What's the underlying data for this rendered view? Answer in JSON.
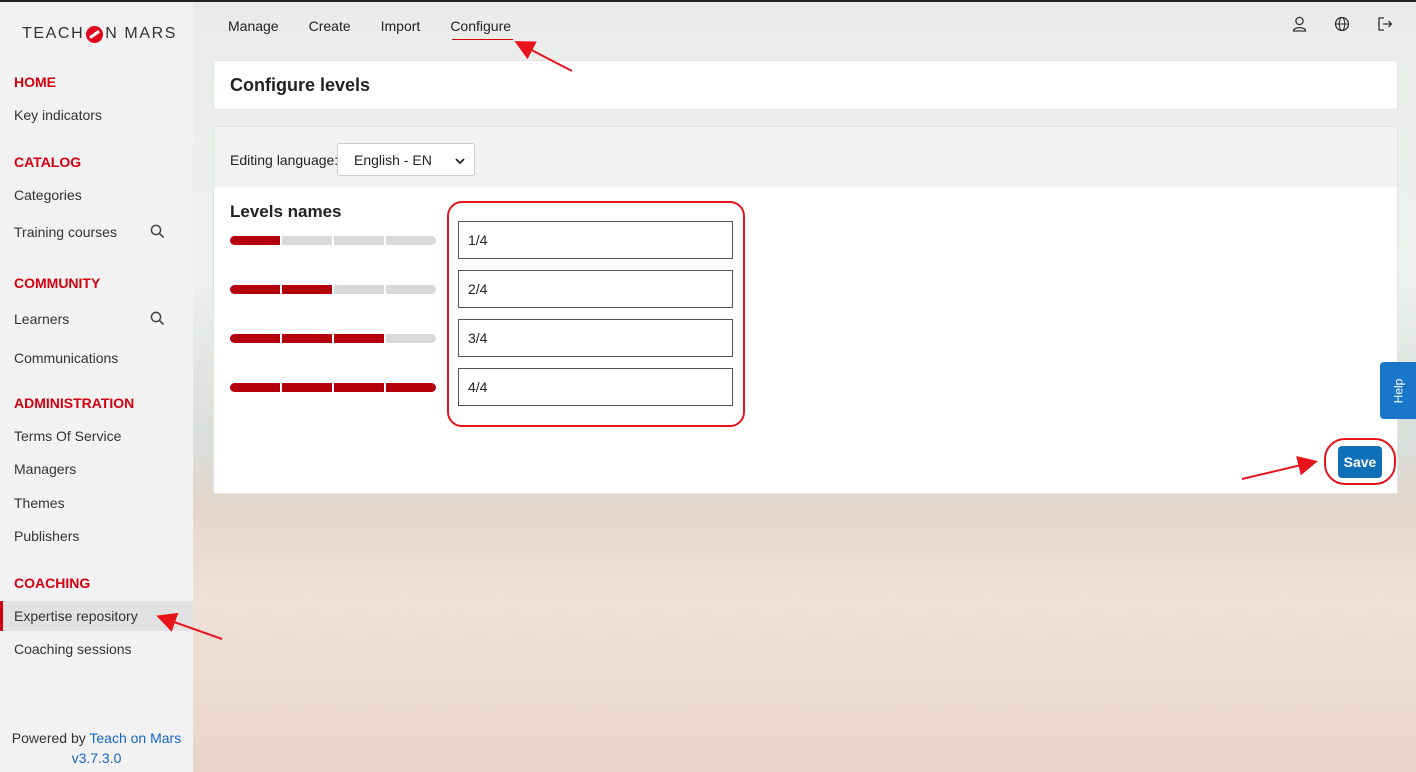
{
  "brand": {
    "logo_left": "TEACH",
    "logo_right": "N MARS",
    "logo_icon": "mars-o-logo-icon",
    "accent_color": "#d4000f",
    "primary_color": "#0f6fb8"
  },
  "sidebar": {
    "sections": [
      {
        "title": "HOME",
        "items": [
          {
            "label": "Key indicators"
          }
        ]
      },
      {
        "title": "CATALOG",
        "items": [
          {
            "label": "Categories"
          },
          {
            "label": "Training courses",
            "icon": "search-icon"
          }
        ]
      },
      {
        "title": "COMMUNITY",
        "items": [
          {
            "label": "Learners",
            "icon": "search-icon"
          },
          {
            "label": "Communications"
          }
        ]
      },
      {
        "title": "ADMINISTRATION",
        "items": [
          {
            "label": "Terms Of Service"
          },
          {
            "label": "Managers"
          },
          {
            "label": "Themes"
          },
          {
            "label": "Publishers"
          }
        ]
      },
      {
        "title": "COACHING",
        "items": [
          {
            "label": "Expertise repository",
            "active": true
          },
          {
            "label": "Coaching sessions"
          }
        ]
      }
    ],
    "footer": {
      "prefix": "Powered by ",
      "link": "Teach on Mars",
      "version": "v3.7.3.0"
    }
  },
  "topnav": {
    "tabs": [
      {
        "label": "Manage"
      },
      {
        "label": "Create"
      },
      {
        "label": "Import"
      },
      {
        "label": "Configure",
        "active": true
      }
    ],
    "icons": [
      "user-icon",
      "globe-icon",
      "logout-icon"
    ]
  },
  "page": {
    "title": "Configure levels",
    "editing_language_label": "Editing language:",
    "editing_language_value": "English - EN",
    "levels_title": "Levels names",
    "levels": [
      {
        "filled": 1,
        "total": 4,
        "value": "1/4"
      },
      {
        "filled": 2,
        "total": 4,
        "value": "2/4"
      },
      {
        "filled": 3,
        "total": 4,
        "value": "3/4"
      },
      {
        "filled": 4,
        "total": 4,
        "value": "4/4"
      }
    ],
    "save_label": "Save"
  },
  "help": {
    "label": "Help"
  }
}
